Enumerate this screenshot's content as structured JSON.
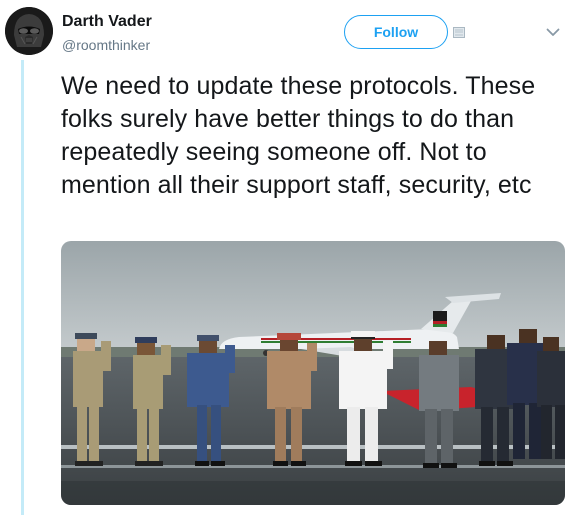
{
  "tweet": {
    "author_name": "Darth Vader",
    "author_handle": "@roomthinker",
    "follow_label": "Follow",
    "text": "We need to update these protocols. These folks surely have better things to do than repeatedly seeing someone off. Not to mention all their support staff, security, etc"
  },
  "colors": {
    "accent": "#1da1f2",
    "text": "#14171a",
    "secondary_text": "#657786",
    "thread_line": "#c4ebf8"
  },
  "icons": {
    "header_icon": "image-icon",
    "menu_icon": "chevron-down-icon"
  }
}
